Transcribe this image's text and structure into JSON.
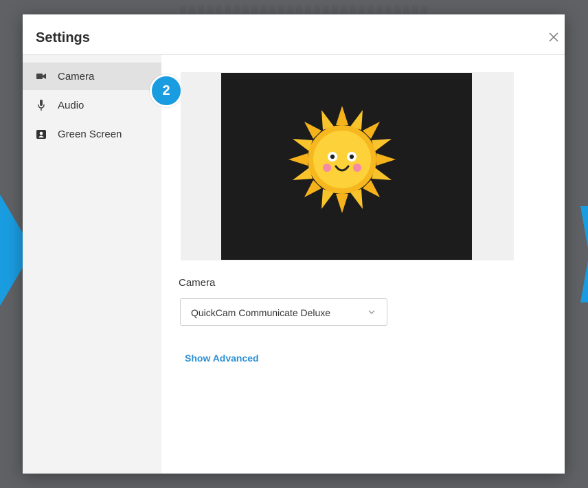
{
  "dialog": {
    "title": "Settings",
    "close_icon": "close-icon"
  },
  "sidebar": {
    "items": [
      {
        "label": "Camera",
        "icon": "video-camera-icon",
        "active": true
      },
      {
        "label": "Audio",
        "icon": "microphone-icon",
        "active": false
      },
      {
        "label": "Green Screen",
        "icon": "contact-card-icon",
        "active": false
      }
    ]
  },
  "step_badge": "2",
  "camera": {
    "label": "Camera",
    "selected_device": "QuickCam Communicate Deluxe",
    "preview_icon": "sun-face-icon"
  },
  "advanced_link": "Show Advanced",
  "colors": {
    "accent": "#1a9de0",
    "link": "#2d90d4",
    "sidebar_bg": "#f3f3f3",
    "active_item_bg": "#e1e1e1",
    "preview_bg": "#1c1c1c"
  }
}
